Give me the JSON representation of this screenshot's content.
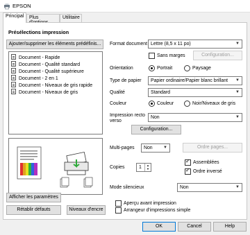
{
  "window": {
    "title": "EPSON"
  },
  "tabs": [
    "Principal",
    "Plus d'options",
    "Utilitaire"
  ],
  "presets": {
    "heading": "Présélections impression",
    "add_button": "Ajouter/supprimer les éléments prédéfinis...",
    "items": [
      "Document - Rapide",
      "Document - Qualité standard",
      "Document - Qualité supérieure",
      "Document - 2 en 1",
      "Document - Niveaux de gris rapide",
      "Document - Niveaux de gris"
    ]
  },
  "left_buttons": {
    "show_settings": "Afficher les paramètres",
    "restore_defaults": "Rétablir défauts",
    "ink_levels": "Niveaux d'encre"
  },
  "settings": {
    "paper_size_label": "Format document",
    "paper_size_value": "Lettre (8,5 x 11 po)",
    "borderless_label": "Sans marges",
    "configuration_button": "Configuration...",
    "orientation_label": "Orientation",
    "portrait": "Portrait",
    "landscape": "Paysage",
    "paper_type_label": "Type de papier",
    "paper_type_value": "Papier ordinaire/Papier blanc brillant",
    "quality_label": "Qualité",
    "quality_value": "Standard",
    "color_label": "Couleur",
    "color_option": "Couleur",
    "grayscale_option": "Noir/Niveaux de gris",
    "duplex_label": "Impression recto verso",
    "duplex_value": "Non",
    "duplex_config_button": "Configuration...",
    "multipage_label": "Multi-pages",
    "multipage_value": "Non",
    "page_order_button": "Ordre pages...",
    "copies_label": "Copies",
    "copies_value": "1",
    "collate_label": "Assemblées",
    "reverse_label": "Ordre inversé",
    "quiet_label": "Mode silencieux",
    "quiet_value": "Non",
    "preview_label": "Aperçu avant impression",
    "simple_arranger_label": "Arrangeur d'impressions simple"
  },
  "footer": {
    "ok": "OK",
    "cancel": "Cancel",
    "help": "Help"
  }
}
